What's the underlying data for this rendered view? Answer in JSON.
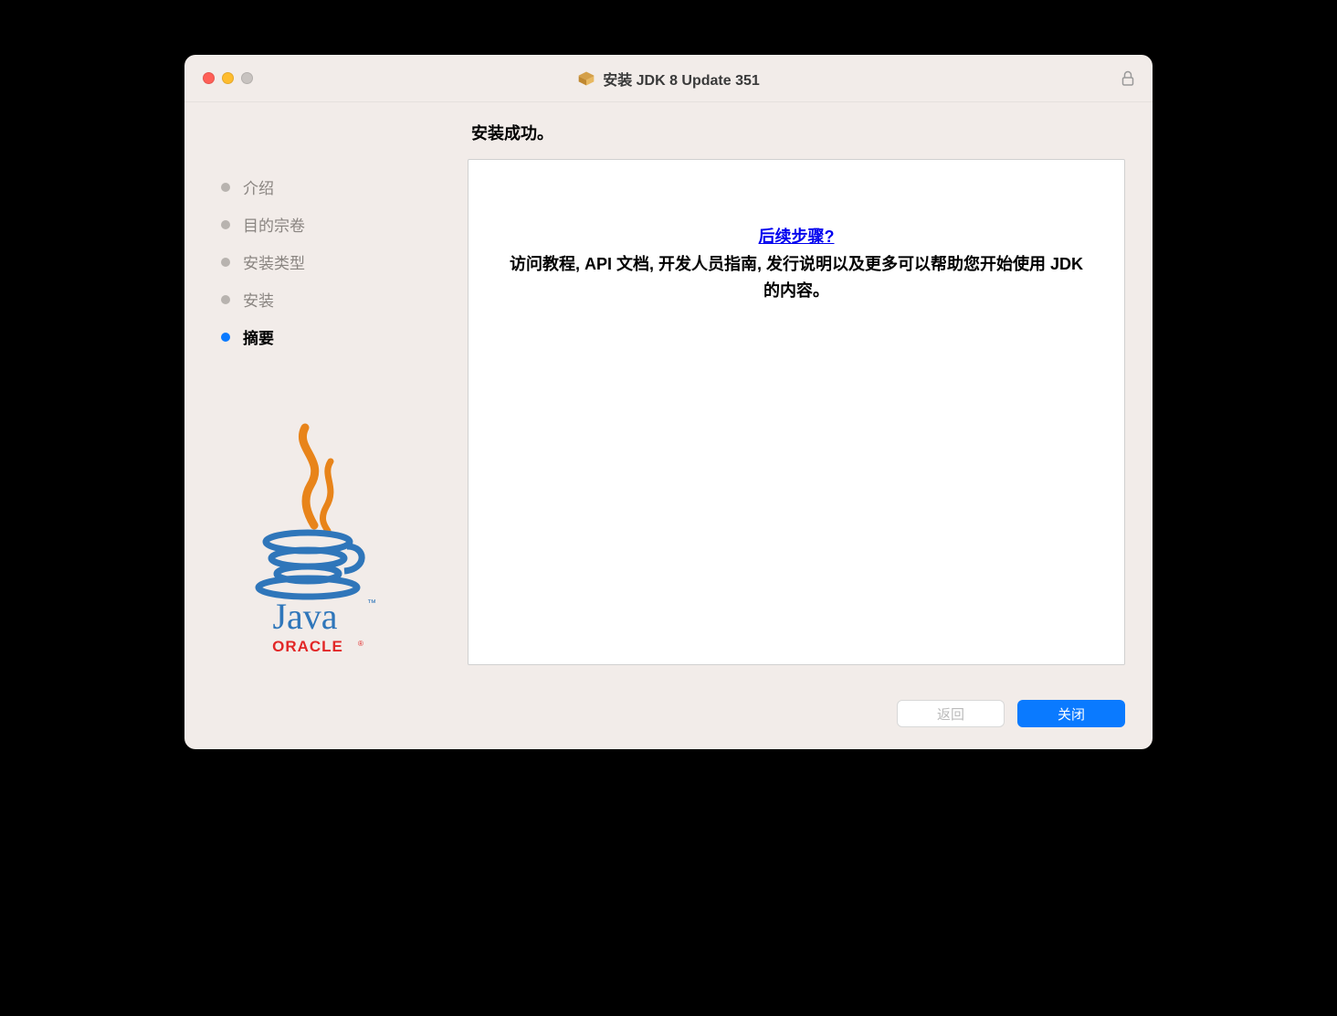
{
  "window": {
    "title": "安装 JDK 8 Update 351"
  },
  "sidebar": {
    "steps": [
      {
        "label": "介绍",
        "state": "done"
      },
      {
        "label": "目的宗卷",
        "state": "done"
      },
      {
        "label": "安装类型",
        "state": "done"
      },
      {
        "label": "安装",
        "state": "done"
      },
      {
        "label": "摘要",
        "state": "current"
      }
    ]
  },
  "content": {
    "heading": "安装成功。",
    "next_steps_link": "后续步骤?",
    "description": "访问教程, API 文档, 开发人员指南, 发行说明以及更多可以帮助您开始使用 JDK 的内容。"
  },
  "footer": {
    "back_label": "返回",
    "close_label": "关闭"
  },
  "logo": {
    "brand": "Java",
    "vendor": "ORACLE"
  }
}
